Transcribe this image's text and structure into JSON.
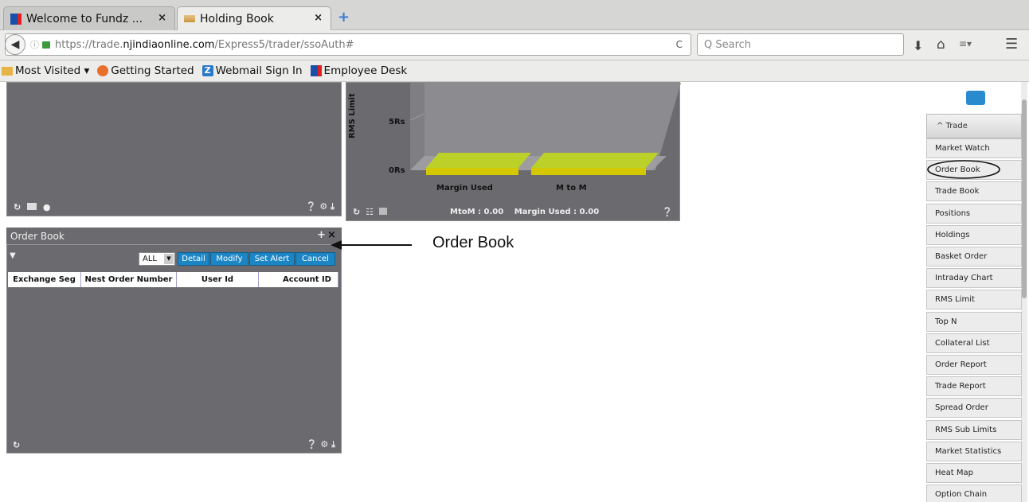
{
  "browser": {
    "tabs": [
      {
        "label": "Welcome to Fundz ...",
        "close": "×"
      },
      {
        "label": "Holding Book",
        "close": "×"
      }
    ],
    "new_tab": "+",
    "url": {
      "prefix": "https://trade.",
      "domain": "njindiaonline.com",
      "path": "/Express5/trader/ssoAuth#"
    },
    "reload": "C",
    "search_placeholder": "Q Search",
    "bookmarks": [
      {
        "label": "Most Visited ▾"
      },
      {
        "label": "Getting Started"
      },
      {
        "label": "Webmail Sign In"
      },
      {
        "label": "Employee Desk"
      }
    ]
  },
  "chart_panel": {
    "ylabel": "RMS Limit",
    "y_ticks": [
      "5Rs",
      "0Rs"
    ],
    "categories": [
      "Margin Used",
      "M to M"
    ],
    "footer": {
      "mtom_label": "MtoM :",
      "mtom_value": "0.00",
      "margin_label": "Margin Used :",
      "margin_value": "0.00"
    }
  },
  "order_book": {
    "title": "Order Book",
    "filter_value": "ALL",
    "buttons": [
      "Detail",
      "Modify",
      "Set Alert",
      "Cancel"
    ],
    "columns": [
      "Exchange Seg",
      "Nest Order Number",
      "User Id",
      "Account ID"
    ]
  },
  "annotation": {
    "label": "Order Book"
  },
  "trade_menu": {
    "header": "^  Trade",
    "items": [
      "Market Watch",
      "Order Book",
      "Trade Book",
      "Positions",
      "Holdings",
      "Basket Order",
      "Intraday Chart",
      "RMS Limit",
      "Top N",
      "Collateral List",
      "Order Report",
      "Trade Report",
      "Spread Order",
      "RMS Sub Limits",
      "Market Statistics",
      "Heat Map",
      "Option Chain"
    ]
  },
  "colors": {
    "panel": "#6b6a6e",
    "button": "#1c86c5",
    "bar_top": "#bcd02a",
    "bar_front": "#d4c800"
  }
}
